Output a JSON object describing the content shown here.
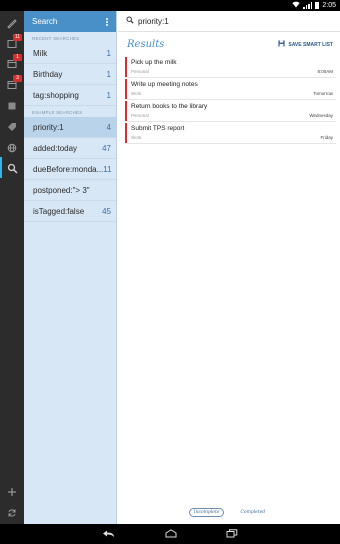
{
  "status": {
    "time": "2:05"
  },
  "rail": {
    "badges": [
      "11",
      "1",
      "3"
    ]
  },
  "search_pane": {
    "header_title": "Search",
    "recent_label": "RECENT SEARCHES",
    "recent": [
      {
        "label": "Milk",
        "count": "1"
      },
      {
        "label": "Birthday",
        "count": "1"
      },
      {
        "label": "tag:shopping",
        "count": "1"
      }
    ],
    "example_label": "EXAMPLE SEARCHES",
    "examples": [
      {
        "label": "priority:1",
        "count": "4"
      },
      {
        "label": "added:today",
        "count": "47"
      },
      {
        "label": "dueBefore:monda...",
        "count": "11"
      },
      {
        "label": "postponed:\"> 3\"",
        "count": ""
      },
      {
        "label": "isTagged:false",
        "count": "45"
      }
    ]
  },
  "main": {
    "query": "priority:1",
    "results_title": "Results",
    "save_label": "SAVE SMART LIST",
    "tasks": [
      {
        "title": "Pick up the milk",
        "list": "Personal",
        "due": "8:00AM"
      },
      {
        "title": "Write up meeting notes",
        "list": "Work",
        "due": "Tomorrow"
      },
      {
        "title": "Return books to the library",
        "list": "Personal",
        "due": "Wednesday"
      },
      {
        "title": "Submit TPS report",
        "list": "Work",
        "due": "Friday"
      }
    ],
    "tabs": [
      "Incomplete",
      "Completed"
    ]
  },
  "colors": {
    "accent": "#4a90c8",
    "priority": "#d32f2f",
    "rail": "#2c2c2c",
    "pane": "#d8e7f5"
  }
}
